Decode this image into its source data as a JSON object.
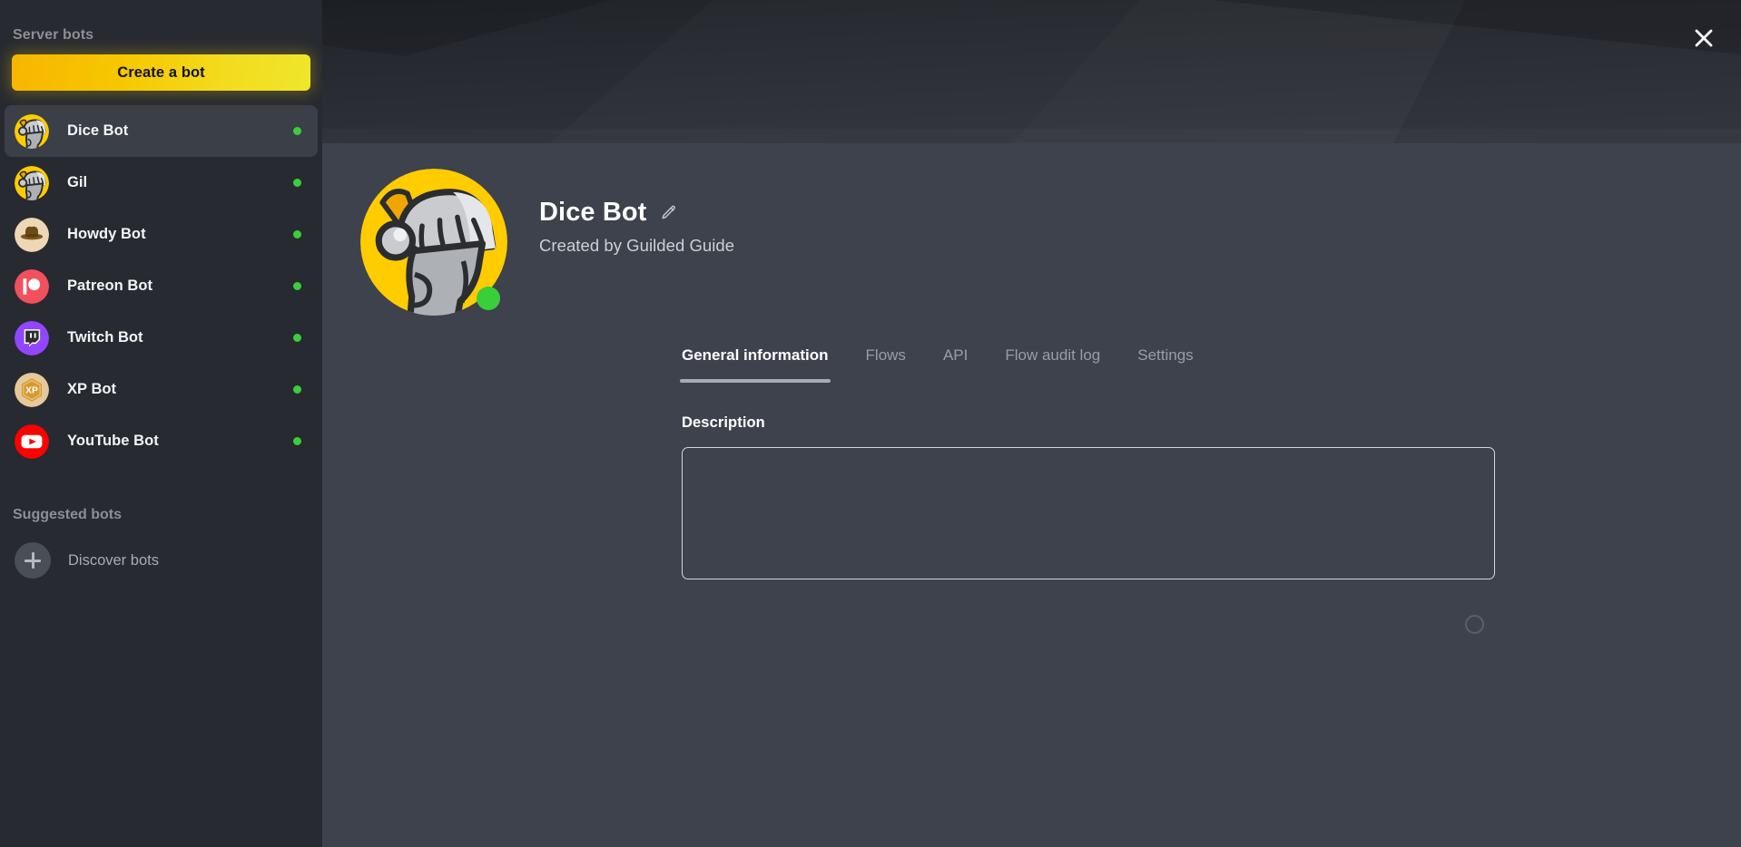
{
  "sidebar": {
    "section_title": "Server bots",
    "create_button_label": "Create a bot",
    "suggested_title": "Suggested bots",
    "discover_label": "Discover bots",
    "bots": [
      {
        "name": "Dice Bot",
        "icon": "knight-helmet-icon",
        "status": "online",
        "selected": true
      },
      {
        "name": "Gil",
        "icon": "knight-helmet-icon",
        "status": "online",
        "selected": false
      },
      {
        "name": "Howdy Bot",
        "icon": "cowboy-hat-icon",
        "status": "online",
        "selected": false
      },
      {
        "name": "Patreon Bot",
        "icon": "patreon-icon",
        "status": "online",
        "selected": false
      },
      {
        "name": "Twitch Bot",
        "icon": "twitch-icon",
        "status": "online",
        "selected": false
      },
      {
        "name": "XP Bot",
        "icon": "xp-hexagon-icon",
        "status": "online",
        "selected": false
      },
      {
        "name": "YouTube Bot",
        "icon": "youtube-icon",
        "status": "online",
        "selected": false
      }
    ]
  },
  "main": {
    "close_icon": "close-icon",
    "bot_name": "Dice Bot",
    "edit_icon": "pencil-edit-icon",
    "created_by": "Created by Guilded Guide",
    "status": "online",
    "tabs": [
      {
        "label": "General information",
        "active": true
      },
      {
        "label": "Flows",
        "active": false
      },
      {
        "label": "API",
        "active": false
      },
      {
        "label": "Flow audit log",
        "active": false
      },
      {
        "label": "Settings",
        "active": false
      }
    ],
    "description": {
      "label": "Description",
      "value": "",
      "placeholder": ""
    },
    "spinner_icon": "loading-spinner-icon"
  },
  "colors": {
    "accent_yellow": "#F6C800",
    "accent_yellow_end": "#EFE62B",
    "status_online": "#3ACF3A",
    "sidebar_bg": "#272A30",
    "main_bg": "#3D424C",
    "banner_bg": "#24272D",
    "selected_bg": "#3B3F48",
    "patreon_red": "#F2505C",
    "twitch_purple": "#9146FF",
    "youtube_red": "#FF0000",
    "howdy_tan": "#EED7B5",
    "xp_tan": "#E5C89B",
    "xp_orange": "#D99A2B"
  }
}
